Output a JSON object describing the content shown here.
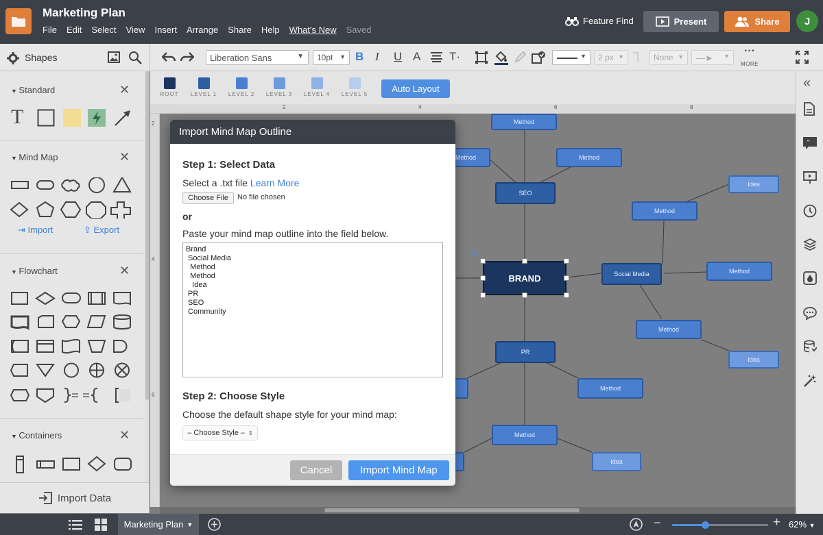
{
  "header": {
    "doc_title": "Marketing Plan",
    "menu": [
      "File",
      "Edit",
      "Select",
      "View",
      "Insert",
      "Arrange",
      "Share",
      "Help",
      "What's New",
      "Saved"
    ],
    "feature_find": "Feature Find",
    "present": "Present",
    "share": "Share",
    "avatar": "J"
  },
  "toolbar": {
    "shapes_label": "Shapes",
    "font": "Liberation Sans",
    "font_size": "10pt",
    "line_width": "2 px",
    "arrow_start": "None",
    "more": "MORE"
  },
  "sidebar": {
    "standard": "Standard",
    "mind_map": "Mind Map",
    "import": "Import",
    "export": "Export",
    "flowchart": "Flowchart",
    "containers": "Containers",
    "import_data": "Import Data"
  },
  "levels": [
    "ROOT",
    "LEVEL 1",
    "LEVEL 2",
    "LEVEL 3",
    "LEVEL 4",
    "LEVEL 5"
  ],
  "level_colors": [
    "#1c355e",
    "#2f5fa3",
    "#4a7fd0",
    "#6e9be0",
    "#8fb2e6",
    "#b7cdee"
  ],
  "auto_layout": "Auto Layout",
  "ruler": {
    "marks": [
      "2",
      "4",
      "6",
      "8"
    ]
  },
  "mindmap": {
    "root": "BRAND",
    "seo": "SEO",
    "social_media": "Social Media",
    "pr": "PR",
    "method": "Method",
    "idea": "Idea"
  },
  "dialog": {
    "title": "Import Mind Map Outline",
    "step1": "Step 1: Select Data",
    "select_file": "Select a .txt file",
    "learn_more": "Learn More",
    "choose_file": "Choose File",
    "no_file": "No file chosen",
    "or": "or",
    "paste_hint": "Paste your mind map outline into the field below.",
    "outline": "Brand\n Social Media\n  Method\n  Method\n   Idea\n PR\n SEO\n Community",
    "step2": "Step 2: Choose Style",
    "style_hint": "Choose the default shape style for your mind map:",
    "style_value": "– Choose Style –",
    "cancel": "Cancel",
    "import": "Import Mind Map"
  },
  "footer": {
    "page_tab": "Marketing Plan",
    "zoom": "62%"
  },
  "colors": {
    "accent_orange": "#e07f3a",
    "accent_blue": "#4f96ee",
    "chrome_dark": "#3b4049"
  }
}
